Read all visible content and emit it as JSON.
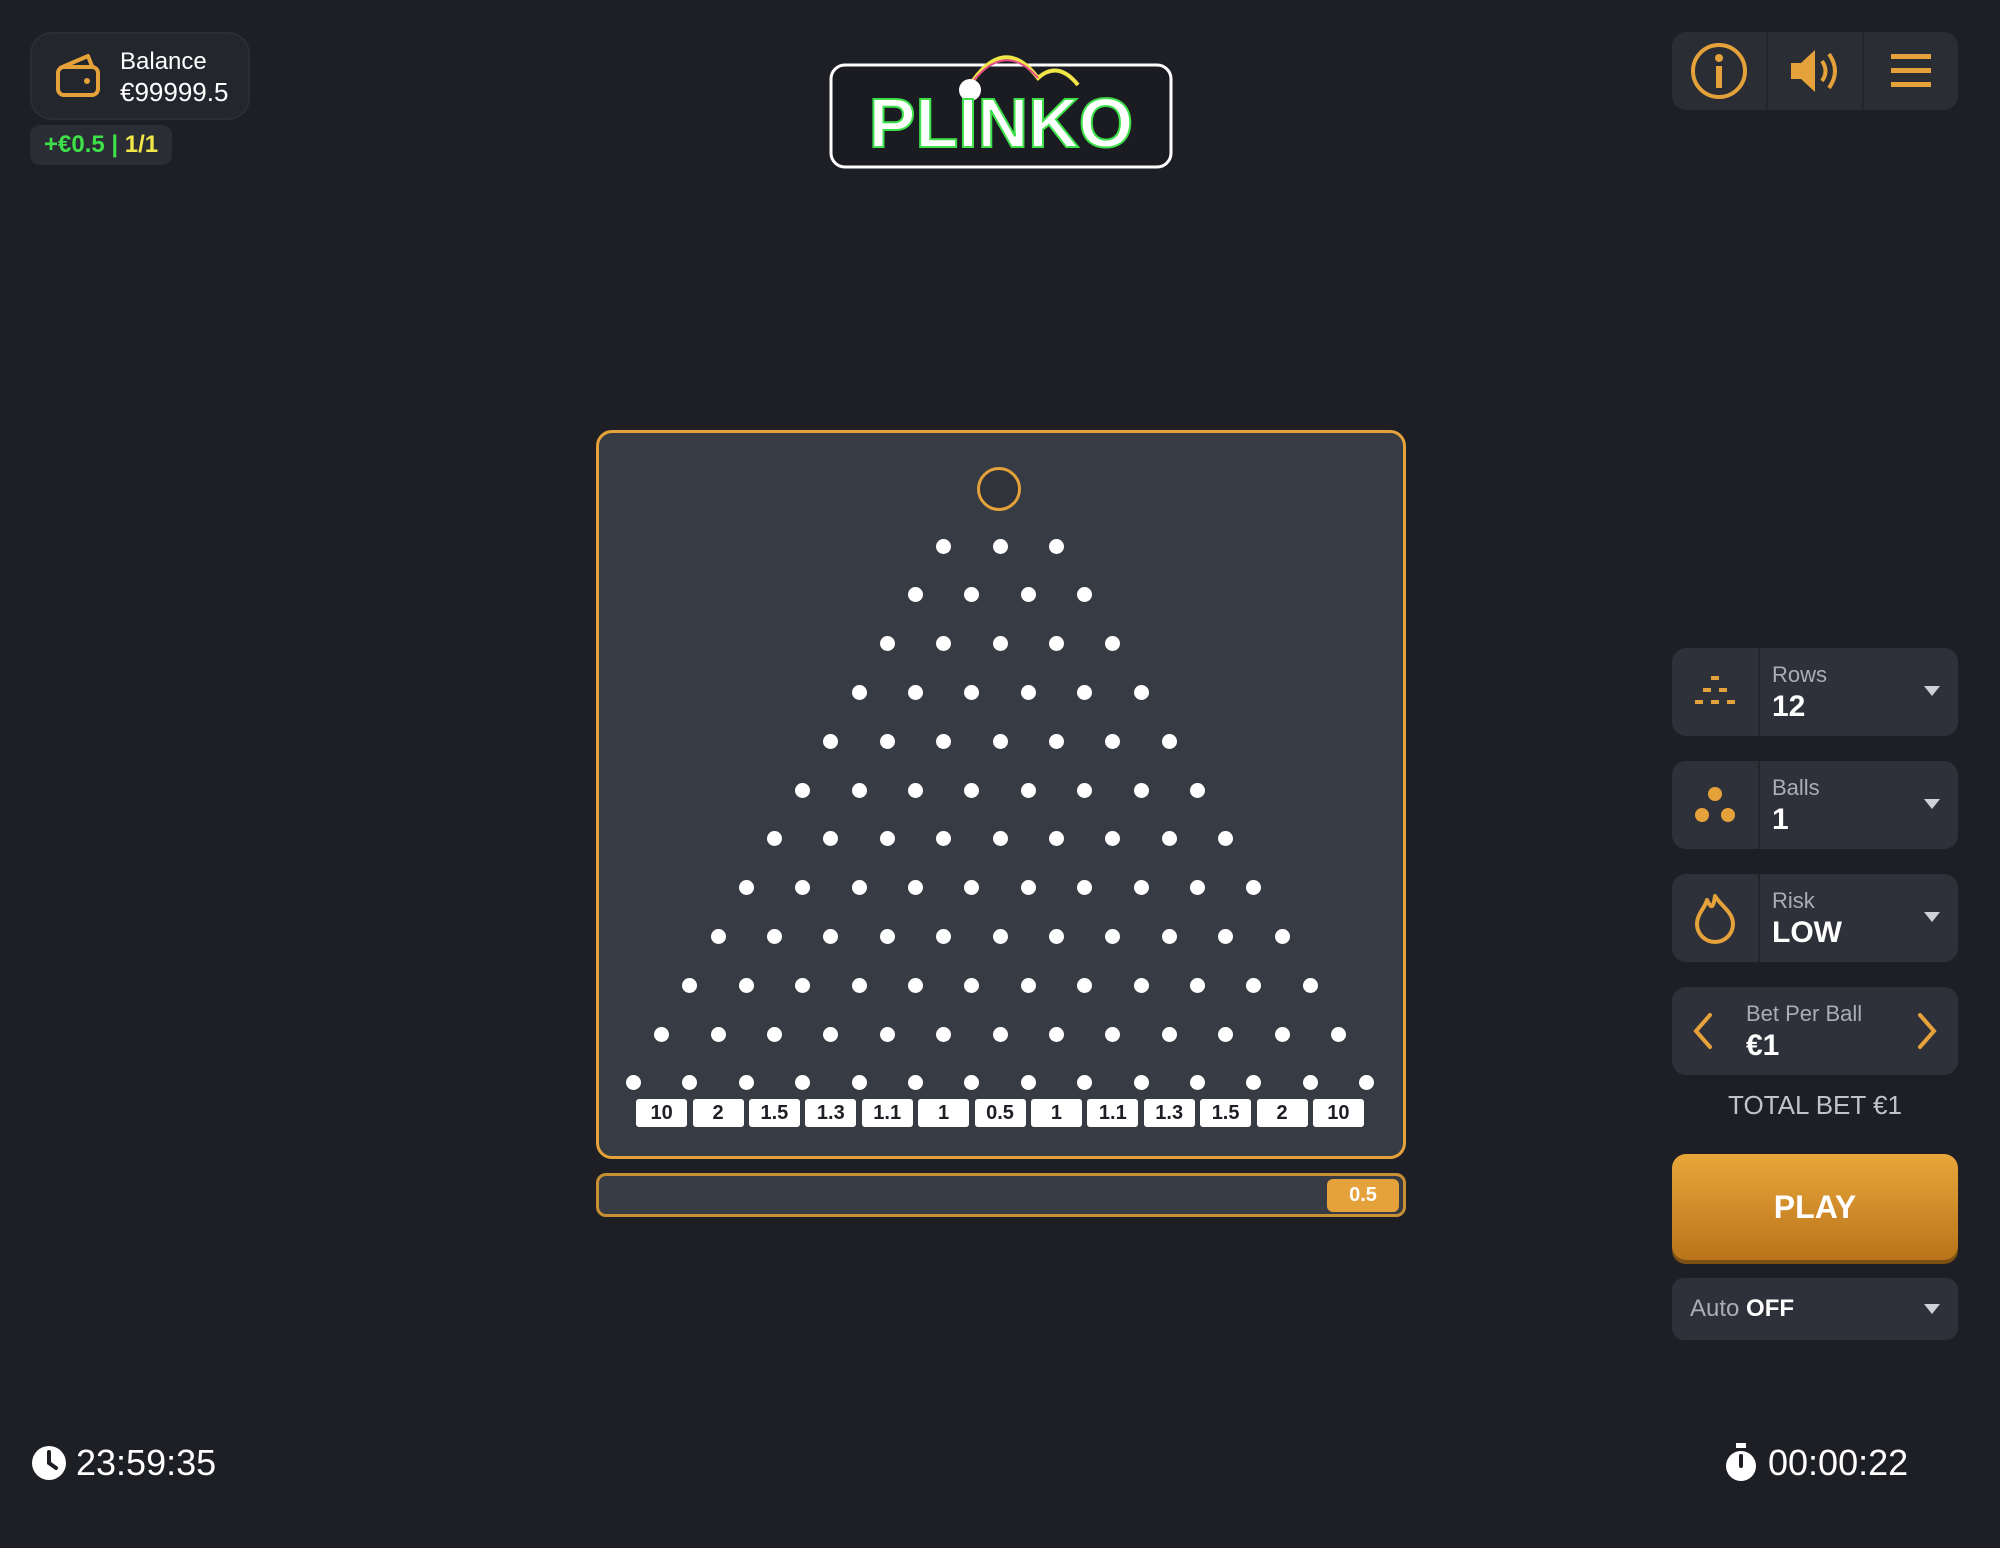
{
  "balance": {
    "label": "Balance",
    "value": "€99999.5"
  },
  "last_win": {
    "amount": "+€0.5 |",
    "count": "1/1"
  },
  "logo": {
    "text": "PLINKO"
  },
  "header_buttons": [
    "info-icon",
    "speaker-icon",
    "menu-icon"
  ],
  "board": {
    "rows": 12,
    "multipliers": [
      "10",
      "2",
      "1.5",
      "1.3",
      "1.1",
      "1",
      "0.5",
      "1",
      "1.1",
      "1.3",
      "1.5",
      "2",
      "10"
    ]
  },
  "history": {
    "last": "0.5"
  },
  "controls": {
    "rows": {
      "label": "Rows",
      "value": "12"
    },
    "balls": {
      "label": "Balls",
      "value": "1"
    },
    "risk": {
      "label": "Risk",
      "value": "LOW"
    },
    "bet": {
      "label": "Bet Per Ball",
      "value": "€1"
    }
  },
  "total_bet": "TOTAL BET €1",
  "play_label": "PLAY",
  "auto": {
    "label": "Auto",
    "value": "OFF"
  },
  "clock": "23:59:35",
  "session_timer": "00:00:22",
  "colors": {
    "accent": "#e6a23a",
    "background": "#1d1f25",
    "board": "#373b43"
  }
}
